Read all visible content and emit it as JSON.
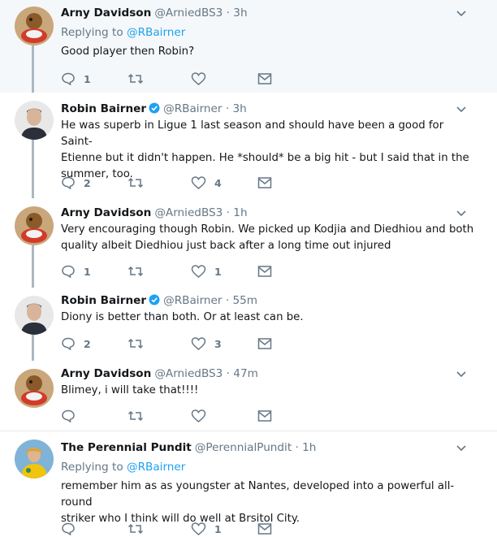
{
  "colors": {
    "accent": "#1da1f2",
    "muted": "#657786",
    "line": "#aab8c2",
    "highlight_bg": "#f5f8fa"
  },
  "icons": {
    "reply": "reply-icon",
    "retweet": "retweet-icon",
    "like": "heart-icon",
    "dm": "envelope-icon",
    "more": "chevron-down-icon",
    "verified": "verified-badge-icon"
  },
  "tweets": [
    {
      "name": "Arny Davidson",
      "handle": "@ArniedBS3",
      "dot": "·",
      "time": "3h",
      "replying_prefix": "Replying to",
      "replying_to": "@RBairner",
      "lines": [
        "Good player then Robin?"
      ],
      "reply_count": "1",
      "like_count": ""
    },
    {
      "name": "Robin Bairner",
      "handle": "@RBairner",
      "dot": "·",
      "time": "3h",
      "lines": [
        "He was superb in Ligue 1 last season and should have been a good for Saint-",
        "Etienne but it didn't happen. He *should* be a big hit - but I said that in the",
        "summer, too."
      ],
      "reply_count": "2",
      "like_count": "4"
    },
    {
      "name": "Arny Davidson",
      "handle": "@ArniedBS3",
      "dot": "·",
      "time": "1h",
      "lines": [
        "Very encouraging though Robin. We picked up Kodjia and Diedhiou and both",
        "quality albeit Diedhiou just back after a long time out injured"
      ],
      "reply_count": "1",
      "like_count": "1"
    },
    {
      "name": "Robin Bairner",
      "handle": "@RBairner",
      "dot": "·",
      "time": "55m",
      "lines": [
        "Diony is better than both. Or at least can be."
      ],
      "reply_count": "2",
      "like_count": "3"
    },
    {
      "name": "Arny Davidson",
      "handle": "@ArniedBS3",
      "dot": "·",
      "time": "47m",
      "lines": [
        "Blimey, i will take that!!!!"
      ],
      "reply_count": "",
      "like_count": ""
    },
    {
      "name": "The Perennial Pundit",
      "handle": "@PerennialPundit",
      "dot": "·",
      "time": "1h",
      "replying_prefix": "Replying to",
      "replying_to": "@RBairner",
      "lines": [
        "remember him as as youngster at Nantes, developed into a powerful all-round",
        "striker who I think will do well at Brsitol City."
      ],
      "reply_count": "",
      "like_count": "1"
    }
  ]
}
